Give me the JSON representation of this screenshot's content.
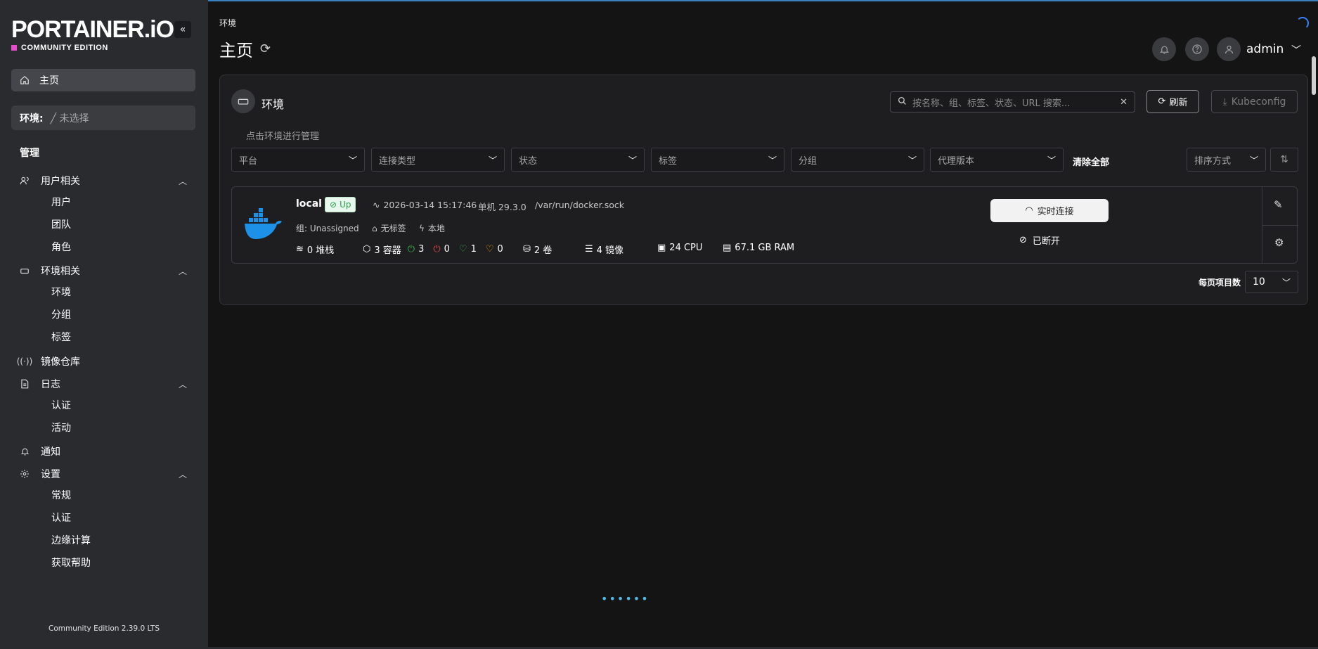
{
  "app": {
    "logo_text": "PORTAINER.iO",
    "edition_text": "COMMUNITY EDITION",
    "version_footer": "Community Edition 2.39.0 LTS",
    "accent_color": "#e64dcd"
  },
  "sidebar": {
    "home_label": "主页",
    "env_label": "环境:",
    "env_value": "╱ 未选择",
    "section_admin": "管理",
    "groups": [
      {
        "label": "用户相关",
        "icon": "users-icon",
        "items": [
          "用户",
          "团队",
          "角色"
        ]
      },
      {
        "label": "环境相关",
        "icon": "server-icon",
        "items": [
          "环境",
          "分组",
          "标签"
        ]
      },
      {
        "label": "镜像仓库",
        "icon": "radio-icon",
        "items": []
      },
      {
        "label": "日志",
        "icon": "file-icon",
        "items": [
          "认证",
          "活动"
        ]
      },
      {
        "label": "通知",
        "icon": "bell-icon",
        "items": []
      },
      {
        "label": "设置",
        "icon": "gear-icon",
        "items": [
          "常规",
          "认证",
          "边缘计算",
          "获取帮助"
        ]
      }
    ]
  },
  "header": {
    "breadcrumb": "环境",
    "title": "主页",
    "user": "admin"
  },
  "panel": {
    "title": "环境",
    "hint": "点击环境进行管理",
    "search_placeholder": "按名称、组、标签、状态、URL 搜索...",
    "refresh_label": "刷新",
    "kubeconfig_label": "Kubeconfig",
    "filters": [
      "平台",
      "连接类型",
      "状态",
      "标签",
      "分组",
      "代理版本"
    ],
    "clear_all": "清除全部",
    "sort_label": "排序方式",
    "per_page_label": "每页项目数",
    "per_page_value": "10"
  },
  "environment": {
    "name": "local",
    "status": "Up",
    "timestamp": "2026-03-14 15:17:46",
    "mode": "单机 29.3.0",
    "socket": "/var/run/docker.sock",
    "group": "组: Unassigned",
    "tags": "无标签",
    "location": "本地",
    "stacks": "0 堆栈",
    "containers": "3 容器",
    "running": "3",
    "stopped": "0",
    "healthy": "1",
    "unhealthy": "0",
    "volumes": "2 卷",
    "images": "4 镜像",
    "cpu": "24 CPU",
    "ram": "67.1 GB RAM",
    "live_connect": "实时连接",
    "disconnected": "已断开"
  },
  "loading_dots": "••••••"
}
